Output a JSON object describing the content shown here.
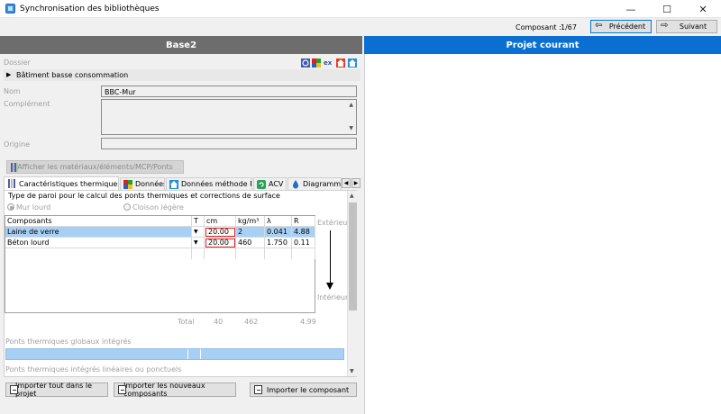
{
  "window": {
    "title": "Synchronisation des bibliothèques",
    "min_glyph": "—",
    "max_glyph": "☐",
    "close_glyph": "✕"
  },
  "nav": {
    "composant_label": "Composant :",
    "composant_count": "1/67",
    "prev_label": "Précédent",
    "next_label": "Suivant",
    "prev_arrow": "⇦",
    "next_arrow": "⇨"
  },
  "left": {
    "header": "Base2",
    "dossier_label": "Dossier",
    "dossier_value": "Bâtiment basse consommation",
    "nom_label": "Nom",
    "nom_value": "BBC-Mur",
    "complement_label": "Complément",
    "complement_value": "",
    "origine_label": "Origine",
    "origine_value": "",
    "show_materials_label": "Afficher les matériaux/éléments/MCP/Ponts",
    "tool_icons": [
      "settings-icon",
      "palette-icon",
      "export-icon",
      "house-red-icon",
      "house-blue-icon"
    ],
    "tool_ex_text": "ex",
    "tabs": [
      {
        "label": "Caractéristiques thermiques",
        "icon": "thermal-icon"
      },
      {
        "label": "Données RT",
        "icon": "rt-data-icon"
      },
      {
        "label": "Données méthode RTS",
        "icon": "house-icon"
      },
      {
        "label": "ACV",
        "icon": "recycle-icon"
      },
      {
        "label": "Diagramme de",
        "icon": "droplet-icon"
      }
    ],
    "tab_prev_glyph": "◀",
    "tab_next_glyph": "▶",
    "paroi_label": "Type de paroi pour le calcul des ponts thermiques et corrections de surface",
    "radio_lourd": "Mur lourd",
    "radio_legere": "Cloison légère",
    "table": {
      "headers": [
        "Composants",
        "T",
        "cm",
        "kg/m³",
        "λ",
        "R"
      ],
      "rows": [
        {
          "name": "Laine de verre",
          "cm": "20.00",
          "kg": "2",
          "lambda": "0.041",
          "r": "4.88"
        },
        {
          "name": "Béton lourd",
          "cm": "20.00",
          "kg": "460",
          "lambda": "1.750",
          "r": "0.11"
        }
      ]
    },
    "exterieur_label": "Extérieur",
    "interieur_label": "Intérieur",
    "total_label": "Total",
    "total_cm": "40",
    "total_kg": "462",
    "total_r": "4.99",
    "ponts_globaux_label": "Ponts thermiques globaux intégrés",
    "ponts_lineaires_label": "Ponts thermiques intégrés linéaires ou ponctuels",
    "scroll_up": "▲",
    "scroll_down": "▼",
    "complement_up": "▲",
    "complement_down": "▼",
    "t_marker": "▼",
    "btn_import_all": "Importer tout dans le projet",
    "btn_import_new": "Importer les nouveaux composants",
    "btn_import_one": "Importer le composant"
  },
  "right": {
    "header": "Projet courant"
  },
  "colors": {
    "accent": "#0a6fd1",
    "left_header": "#6d6d6d",
    "selection": "#a8d0f5",
    "highlight_border": "#e02020"
  }
}
